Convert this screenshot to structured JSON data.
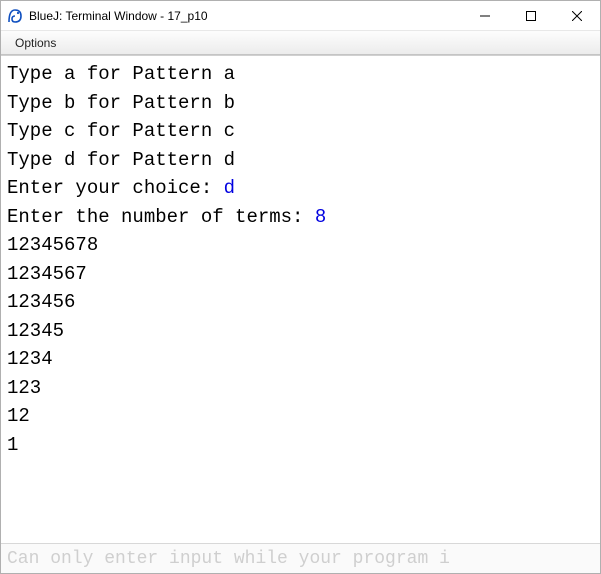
{
  "window": {
    "title": "BlueJ: Terminal Window - 17_p10"
  },
  "menubar": {
    "options": "Options"
  },
  "terminal": {
    "lines": [
      {
        "prompt": "Type a for Pattern a",
        "input": ""
      },
      {
        "prompt": "Type b for Pattern b",
        "input": ""
      },
      {
        "prompt": "Type c for Pattern c",
        "input": ""
      },
      {
        "prompt": "Type d for Pattern d",
        "input": ""
      },
      {
        "prompt": "Enter your choice: ",
        "input": "d"
      },
      {
        "prompt": "Enter the number of terms: ",
        "input": "8"
      },
      {
        "prompt": "12345678",
        "input": ""
      },
      {
        "prompt": "1234567",
        "input": ""
      },
      {
        "prompt": "123456",
        "input": ""
      },
      {
        "prompt": "12345",
        "input": ""
      },
      {
        "prompt": "1234",
        "input": ""
      },
      {
        "prompt": "123",
        "input": ""
      },
      {
        "prompt": "12",
        "input": ""
      },
      {
        "prompt": "1",
        "input": ""
      }
    ]
  },
  "inputbar": {
    "placeholder": "Can only enter input while your program i"
  }
}
